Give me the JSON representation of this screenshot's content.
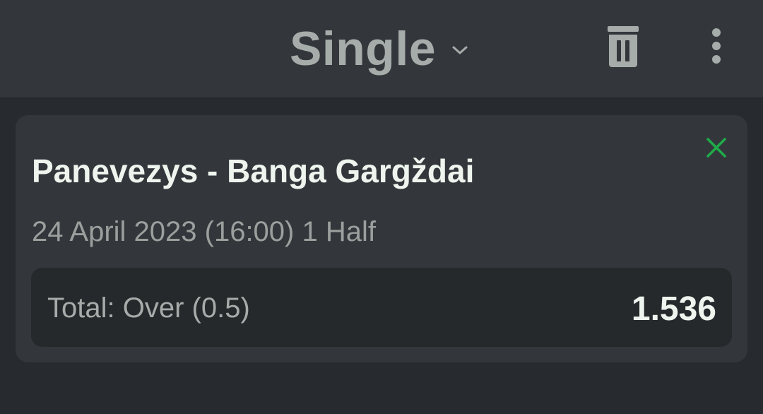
{
  "header": {
    "title": "Single",
    "chevron_icon": "chevron-down-icon",
    "trash_icon": "trash-icon",
    "menu_icon": "more-vertical-icon"
  },
  "bet": {
    "close_icon": "close-icon",
    "match": "Panevezys - Banga Gargždai",
    "datetime": "24 April 2023 (16:00) 1 Half",
    "market": "Total: Over (0.5)",
    "odds": "1.536"
  },
  "colors": {
    "background": "#272b2f",
    "header_bg": "#33373b",
    "card_bg": "#33373b",
    "bet_row_bg": "#25292c",
    "accent_green": "#1fab4a",
    "primary_text": "#eef5ee",
    "secondary_text": "#9aa09d",
    "icon_gray": "#a6aca9"
  }
}
